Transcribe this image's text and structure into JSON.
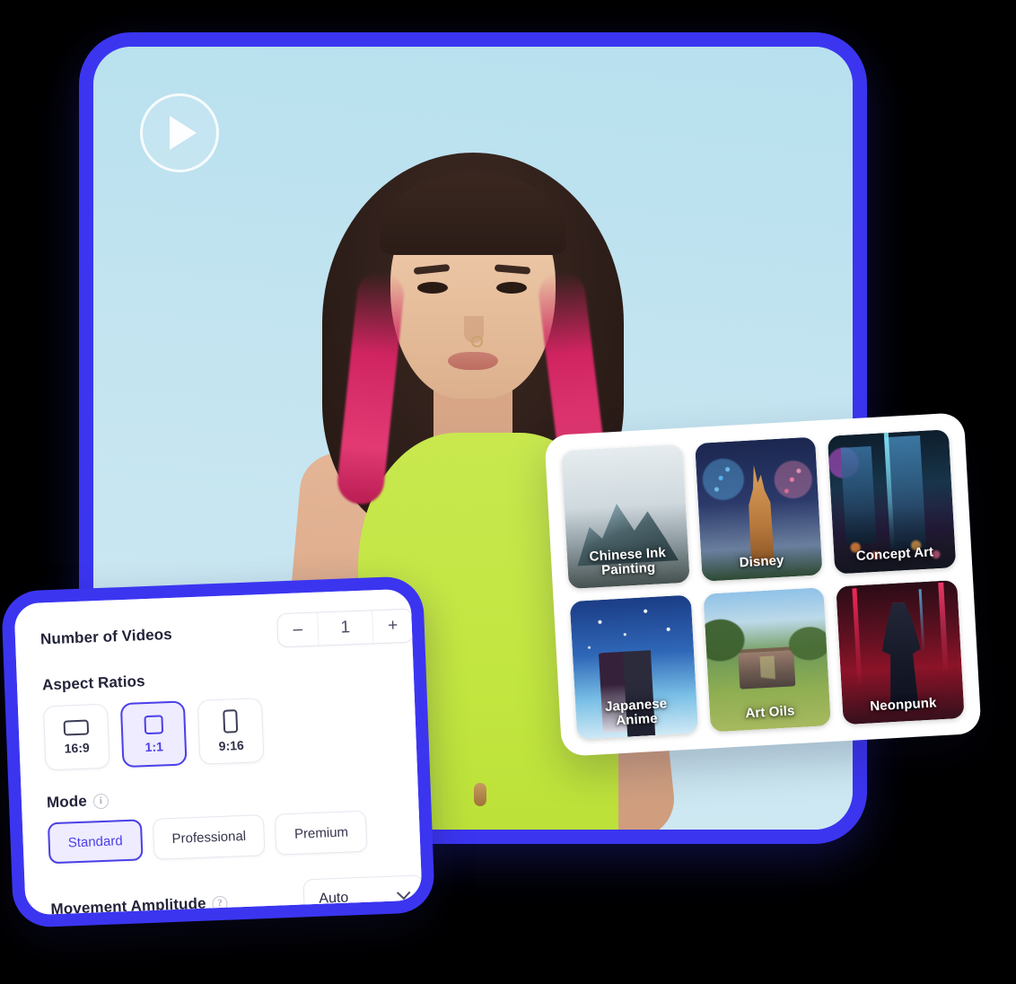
{
  "video": {
    "play_button": "play-icon",
    "subject_description": "Portrait of a woman with dark hair with pink highlights wearing a lime green crop top on a light blue background"
  },
  "styles_panel": {
    "presets": [
      {
        "label": "Chinese Ink\nPainting",
        "art": "art-ink"
      },
      {
        "label": "Disney",
        "art": "art-disney"
      },
      {
        "label": "Concept Art",
        "art": "art-concept"
      },
      {
        "label": "Japanese\nAnime",
        "art": "art-anime"
      },
      {
        "label": "Art Oils",
        "art": "art-oils"
      },
      {
        "label": "Neonpunk",
        "art": "art-neon"
      }
    ]
  },
  "settings_panel": {
    "number_of_videos": {
      "label": "Number of Videos",
      "decrement": "–",
      "value": "1",
      "increment": "+"
    },
    "aspect_ratios": {
      "label": "Aspect Ratios",
      "options": [
        {
          "label": "16:9",
          "selected": false
        },
        {
          "label": "1:1",
          "selected": true
        },
        {
          "label": "9:16",
          "selected": false
        }
      ]
    },
    "mode": {
      "label": "Mode",
      "info_icon": "info-icon",
      "options": [
        {
          "label": "Standard",
          "selected": true
        },
        {
          "label": "Professional",
          "selected": false
        },
        {
          "label": "Premium",
          "selected": false
        }
      ]
    },
    "movement_amplitude": {
      "label": "Movement Amplitude",
      "help_icon": "help-icon",
      "value": "Auto",
      "chevron": "chevron-down-icon"
    }
  },
  "colors": {
    "accent_blue": "#3b35f0",
    "accent_indigo": "#4b3fe8",
    "selected_bg": "#eeecfe",
    "video_bg": "#bfe2ef",
    "panel_white": "#ffffff",
    "page_bg": "#000000"
  }
}
